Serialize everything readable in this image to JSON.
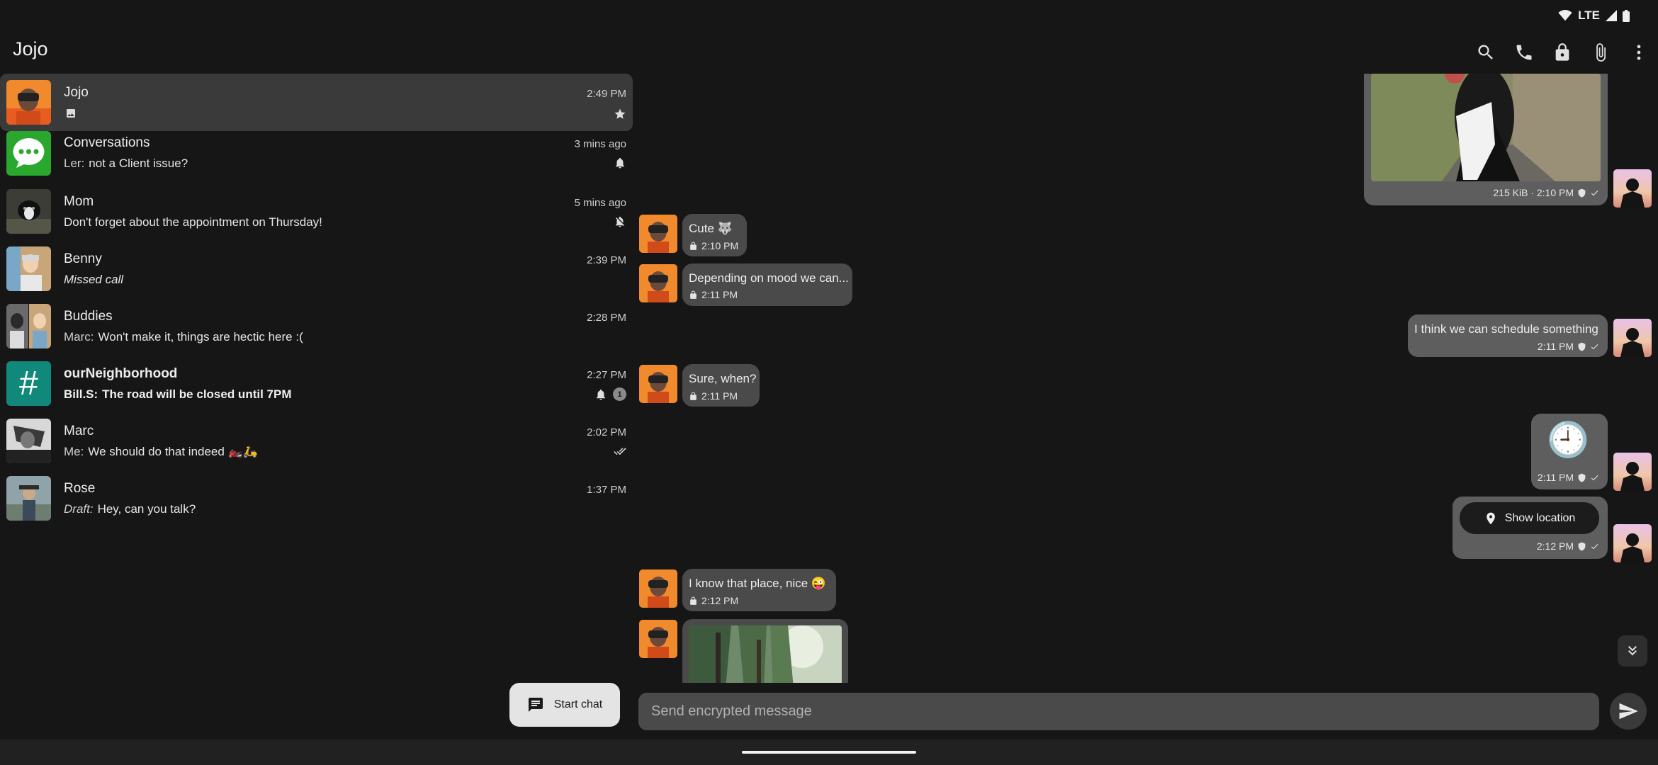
{
  "status_bar": {
    "network": "LTE"
  },
  "app_bar": {
    "title": "Jojo",
    "actions": [
      "search-icon",
      "phone-icon",
      "lock-icon",
      "attach-icon",
      "more-vert-icon"
    ]
  },
  "conversations": [
    {
      "name": "Jojo",
      "preview": "",
      "time": "2:49 PM",
      "status_icon": "star-icon",
      "selected": true
    },
    {
      "name": "Conversations",
      "sender": "Ler:",
      "preview": "not a Client issue?",
      "time": "3 mins ago",
      "status_icon": "bell-icon"
    },
    {
      "name": "Mom",
      "preview": "Don't forget about the appointment on Thursday!",
      "time": "5 mins ago",
      "status_icon": "bell-off-icon"
    },
    {
      "name": "Benny",
      "preview": "Missed call",
      "time": "2:39 PM"
    },
    {
      "name": "Buddies",
      "sender": "Marc:",
      "preview": "Won't make it, things are hectic here :(",
      "time": "2:28 PM"
    },
    {
      "name": "ourNeighborhood",
      "sender": "Bill.S:",
      "preview": "The road will be closed until 7PM",
      "time": "2:27 PM",
      "status_icon": "bell-icon",
      "badge": "1",
      "avatar_glyph": "#"
    },
    {
      "name": "Marc",
      "sender": "Me:",
      "preview": "We should do that indeed 🏍️🛵",
      "time": "2:02 PM",
      "status_icon": "double-check-icon"
    },
    {
      "name": "Rose",
      "sender": "Draft:",
      "preview": "Hey, can you talk?",
      "time": "1:37 PM"
    }
  ],
  "fab": {
    "label": "Start chat"
  },
  "messages": [
    {
      "dir": "out",
      "kind": "image",
      "meta": "215 KiB · 2:10 PM"
    },
    {
      "dir": "in",
      "text": "Cute 🐺",
      "time": "2:10 PM"
    },
    {
      "dir": "in",
      "text": "Depending on mood we can...",
      "time": "2:11 PM"
    },
    {
      "dir": "out",
      "text": "I think we can schedule something",
      "time": "2:11 PM"
    },
    {
      "dir": "in",
      "text": "Sure, when?",
      "time": "2:11 PM"
    },
    {
      "dir": "out",
      "kind": "emoji",
      "text": "🕘",
      "time": "2:11 PM"
    },
    {
      "dir": "out",
      "kind": "location",
      "button": "Show location",
      "time": "2:12 PM"
    },
    {
      "dir": "in",
      "text": "I know that place, nice 😜",
      "time": "2:12 PM"
    },
    {
      "dir": "in",
      "kind": "image"
    }
  ],
  "composer": {
    "placeholder": "Send encrypted message"
  }
}
